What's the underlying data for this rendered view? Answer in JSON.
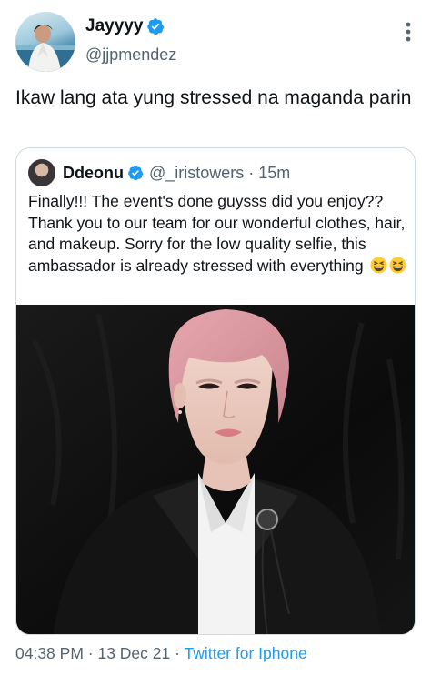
{
  "tweet": {
    "author_name": "Jayyyy",
    "author_handle": "@jjpmendez",
    "text": "Ikaw lang ata yung stressed na maganda parin",
    "timestamp": "04:38 PM · 13 Dec 21 · ",
    "source": "Twitter for Iphone"
  },
  "quoted": {
    "author_name": "Ddeonu",
    "author_handle": "@_iristowers · 15m",
    "text": "Finally!!! The event's done guysss did you enjoy?? Thank you to our team for our wonderful clothes, hair, and makeup. Sorry for the low quality selfie, this ambassador is already stressed with everything"
  },
  "icons": {
    "verified": "verified-badge-icon",
    "more": "more-vertical-icon",
    "emoji": "grinning-squinting-face-emoji"
  },
  "colors": {
    "accent": "#1d9bf0",
    "text_primary": "#0f1419",
    "text_secondary": "#536471",
    "border": "#cfd9de"
  }
}
